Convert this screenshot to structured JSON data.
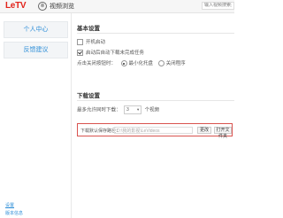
{
  "app": {
    "logo": "LeTV",
    "tab_title": "视频浏览",
    "search_placeholder": "输入视频搜索关键词"
  },
  "sidebar": {
    "items": [
      {
        "label": "个人中心"
      },
      {
        "label": "反馈建议"
      }
    ],
    "bottom_links": [
      {
        "label": "设置"
      },
      {
        "label": "版本信息"
      }
    ]
  },
  "basic": {
    "title": "基本设置",
    "autostart": "开机启动",
    "auto_resume": "启动后自动下载未完成任务",
    "close_label": "点击关闭按钮时：",
    "close_options": [
      {
        "label": "最小化托盘",
        "selected": true
      },
      {
        "label": "关闭程序",
        "selected": false
      }
    ]
  },
  "download": {
    "title": "下载设置",
    "max_label": "最多允许同时下载：",
    "max_value": "3",
    "max_unit": "个视频",
    "path_label": "下载默认保存路径：",
    "path_value": "D:\\我的影视\\LeVideos",
    "change_button": "更改",
    "open_button": "打开文件夹"
  },
  "colors": {
    "accent": "#2f8fd8",
    "brand": "#e2231a",
    "highlight": "#d9534f"
  }
}
